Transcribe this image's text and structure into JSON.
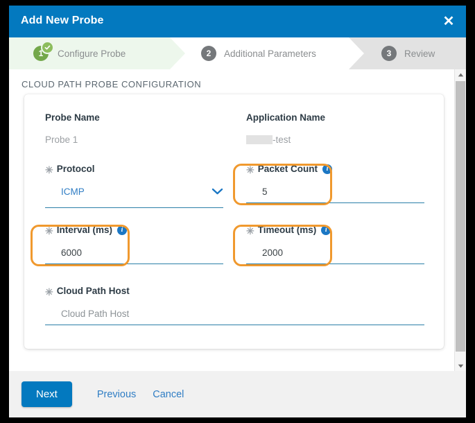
{
  "dialog": {
    "title": "Add New Probe",
    "close_icon": "close-icon"
  },
  "stepper": {
    "steps": [
      {
        "number": "1",
        "label": "Configure Probe",
        "state": "complete"
      },
      {
        "number": "2",
        "label": "Additional Parameters",
        "state": "upcoming"
      },
      {
        "number": "3",
        "label": "Review",
        "state": "upcoming"
      }
    ]
  },
  "section": {
    "title": "CLOUD PATH PROBE CONFIGURATION"
  },
  "form": {
    "required_marker": "✳",
    "probe_name": {
      "label": "Probe Name",
      "value": "Probe 1"
    },
    "application_name": {
      "label": "Application Name",
      "value": "-test",
      "redacted": true
    },
    "protocol": {
      "label": "Protocol",
      "value": "ICMP",
      "required": true,
      "chevron_icon": "chevron-down-icon"
    },
    "packet_count": {
      "label": "Packet Count",
      "value": "5",
      "required": true,
      "info_icon": "info-icon",
      "highlighted": true
    },
    "interval": {
      "label": "Interval (ms)",
      "value": "6000",
      "required": true,
      "info_icon": "info-icon",
      "highlighted": true
    },
    "timeout": {
      "label": "Timeout (ms)",
      "value": "2000",
      "required": true,
      "info_icon": "info-icon",
      "highlighted": true
    },
    "cloud_path_host": {
      "label": "Cloud Path Host",
      "value": "",
      "placeholder": "Cloud Path Host",
      "required": true
    }
  },
  "footer": {
    "next": "Next",
    "previous": "Previous",
    "cancel": "Cancel"
  },
  "scrollbar": {
    "up_icon": "scroll-up-arrow-icon",
    "down_icon": "scroll-down-arrow-icon"
  },
  "colors": {
    "brand_blue": "#0379bf",
    "step_green": "#74a84b",
    "highlight_orange": "#f0992e",
    "underline_blue": "#2a7fa8",
    "link_blue": "#2f7dc4"
  }
}
